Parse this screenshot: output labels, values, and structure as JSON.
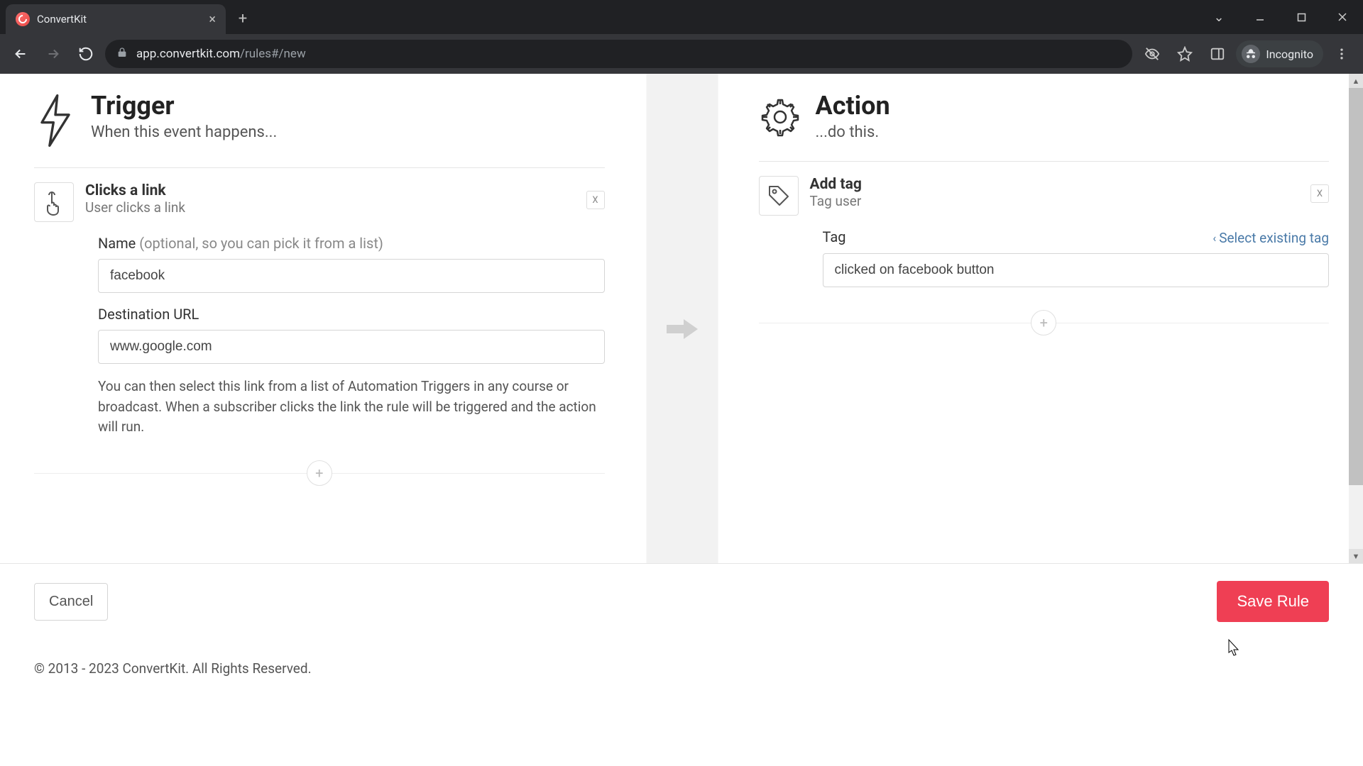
{
  "browser": {
    "tab_title": "ConvertKit",
    "url_host": "app.convertkit.com",
    "url_path": "/rules#/new",
    "incognito_label": "Incognito"
  },
  "trigger": {
    "title": "Trigger",
    "subtitle": "When this event happens...",
    "card_title": "Clicks a link",
    "card_sub": "User clicks a link",
    "close": "X",
    "name_label": "Name",
    "name_hint": "(optional, so you can pick it from a list)",
    "name_value": "facebook",
    "url_label": "Destination URL",
    "url_value": "www.google.com",
    "help": "You can then select this link from a list of Automation Triggers in any course or broadcast. When a subscriber clicks the link the rule will be triggered and the action will run."
  },
  "action": {
    "title": "Action",
    "subtitle": "...do this.",
    "card_title": "Add tag",
    "card_sub": "Tag user",
    "close": "X",
    "tag_label": "Tag",
    "select_existing": "Select existing tag",
    "tag_value": "clicked on facebook button"
  },
  "footer": {
    "cancel": "Cancel",
    "save": "Save Rule",
    "copyright": "© 2013 - 2023 ConvertKit. All Rights Reserved."
  }
}
